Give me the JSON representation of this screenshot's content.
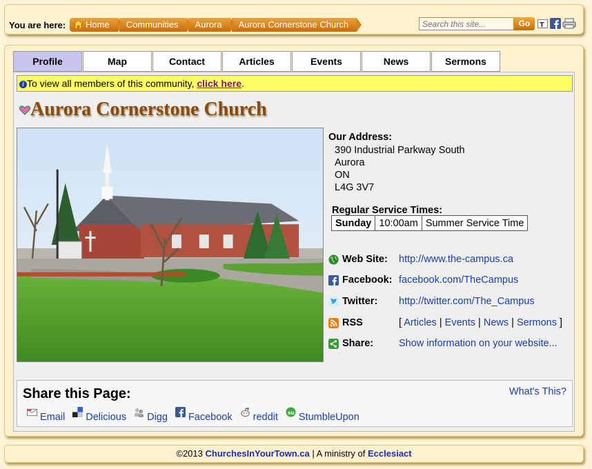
{
  "breadcrumb": {
    "label": "You are here:",
    "items": [
      "Home",
      "Communities",
      "Aurora",
      "Aurora Cornerstone Church"
    ]
  },
  "search": {
    "placeholder": "Search this site...",
    "button": "Go"
  },
  "tabs": [
    "Profile",
    "Map",
    "Contact",
    "Articles",
    "Events",
    "News",
    "Sermons"
  ],
  "notice": {
    "text": "To view all members of this community, ",
    "link": "click here",
    "suffix": "."
  },
  "church": {
    "name": "Aurora Cornerstone Church",
    "address_label": "Our Address:",
    "address": [
      "390 Industrial Parkway South",
      "Aurora",
      "ON",
      "L4G 3V7"
    ],
    "service_label": "Regular Service Times:",
    "service": {
      "day": "Sunday",
      "time": "10:00am",
      "note": "Summer Service Time"
    }
  },
  "links": {
    "website": {
      "label": "Web Site:",
      "value": "http://www.the-campus.ca"
    },
    "facebook": {
      "label": "Facebook:",
      "value": "facebook.com/TheCampus"
    },
    "twitter": {
      "label": "Twitter:",
      "value": "http://twitter.com/The_Campus"
    },
    "rss": {
      "label": "RSS",
      "open": "[",
      "items": [
        "Articles",
        "Events",
        "News",
        "Sermons"
      ],
      "sep": "|",
      "close": "]"
    },
    "share": {
      "label": "Share:",
      "value": "Show information on your website..."
    }
  },
  "share_page": {
    "title": "Share this Page:",
    "whats_this": "What's This?",
    "items": [
      "Email",
      "Delicious",
      "Digg",
      "Facebook",
      "reddit",
      "StumbleUpon"
    ]
  },
  "footer": {
    "copyright": "©2013 ",
    "site": "ChurchesInYourTown.ca",
    "middle": " | A ministry of ",
    "org": "Ecclesiact"
  },
  "colors": {
    "accent": "#d98419",
    "tab_active": "#c7c5ef",
    "title": "#8a4a0c",
    "link": "#1a3fae",
    "notice_bg": "#ffff66"
  }
}
